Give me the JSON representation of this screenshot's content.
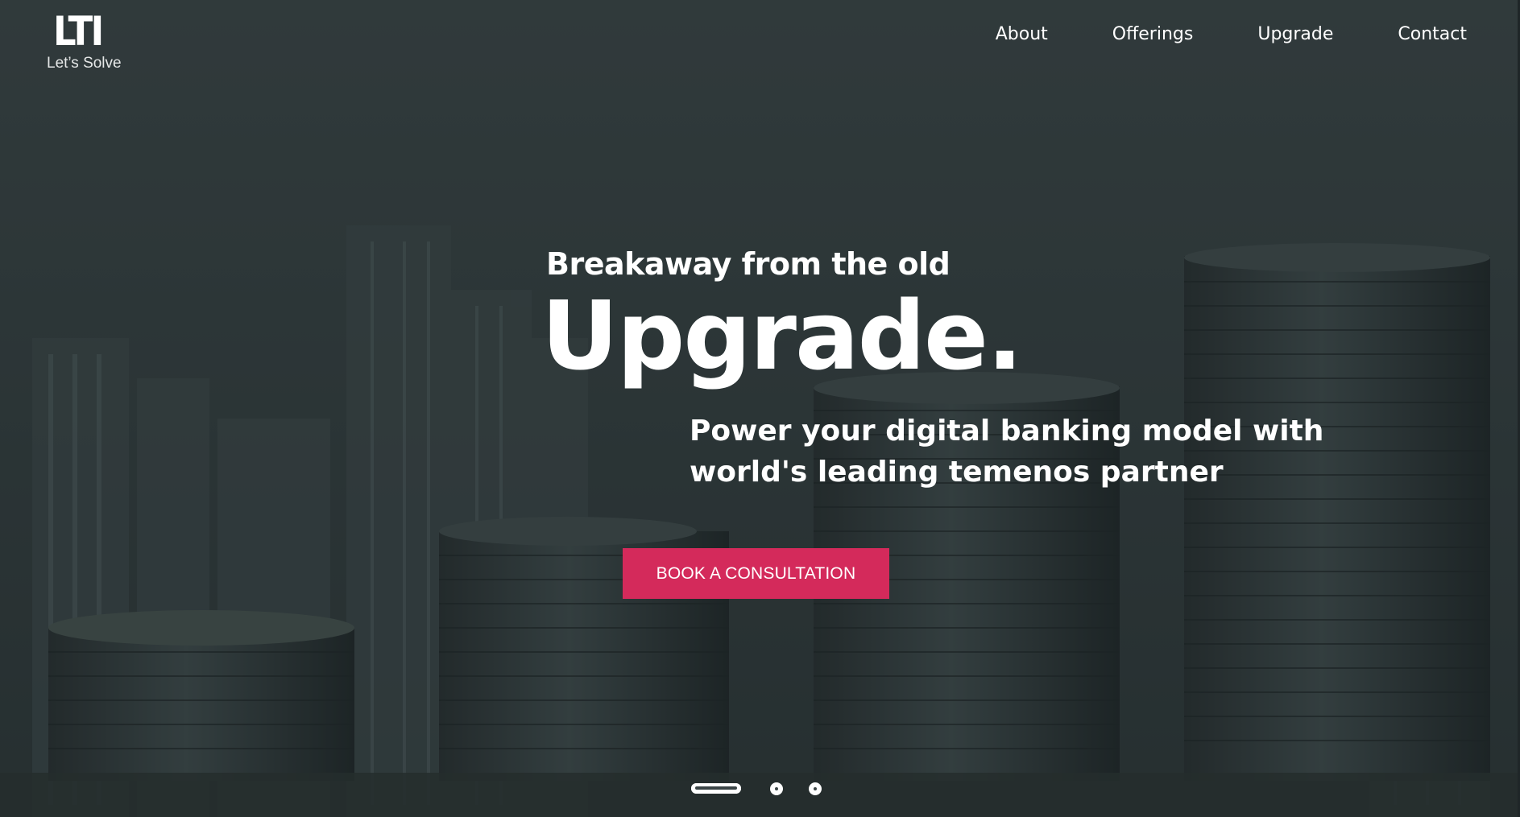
{
  "header": {
    "logo_text": "LTI",
    "logo_tagline": "Let’s Solve",
    "nav": [
      {
        "label": "About"
      },
      {
        "label": "Offerings"
      },
      {
        "label": "Upgrade"
      },
      {
        "label": "Contact"
      }
    ]
  },
  "hero": {
    "eyebrow": "Breakaway from the old",
    "headline": "Upgrade.",
    "subheadline": "Power your digital banking model with world's leading temenos partner",
    "cta_label": "BOOK A CONSULTATION",
    "background": "city skyline with stacks of coins"
  },
  "slider": {
    "total_slides": 3,
    "active_slide": 1
  },
  "colors": {
    "accent": "#d42a5b",
    "background": "#2c3537",
    "text": "#ffffff"
  }
}
